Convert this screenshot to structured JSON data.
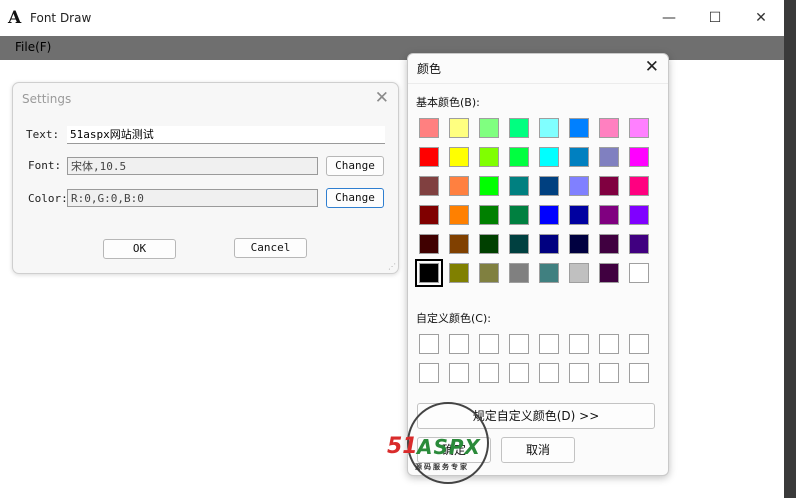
{
  "app": {
    "title": "Font Draw",
    "icon": "font-a-icon",
    "window_buttons": {
      "minimize": "—",
      "maximize": "☐",
      "close": "✕"
    }
  },
  "menu": {
    "file": "File(F)"
  },
  "settings": {
    "title": "Settings",
    "text_label": "Text:",
    "text_value": "51aspx网站测试",
    "font_label": "Font:",
    "font_value": "宋体,10.5",
    "color_label": "Color:",
    "color_value": "R:0,G:0,B:0",
    "change_font": "Change",
    "change_color": "Change",
    "ok": "OK",
    "cancel": "Cancel"
  },
  "color_dialog": {
    "title": "颜色",
    "basic_label": "基本颜色(B):",
    "custom_label": "自定义颜色(C):",
    "define_button": "规定自定义颜色(D) >>",
    "ok": "确定",
    "cancel": "取消",
    "selected": "#000000",
    "basic_colors": [
      [
        "#ff8080",
        "#ffff80",
        "#80ff80",
        "#00ff80",
        "#80ffff",
        "#0080ff",
        "#ff80c0",
        "#ff80ff"
      ],
      [
        "#ff0000",
        "#ffff00",
        "#80ff00",
        "#00ff40",
        "#00ffff",
        "#0080c0",
        "#8080c0",
        "#ff00ff"
      ],
      [
        "#804040",
        "#ff8040",
        "#00ff00",
        "#008080",
        "#004080",
        "#8080ff",
        "#800040",
        "#ff0080"
      ],
      [
        "#800000",
        "#ff8000",
        "#008000",
        "#008040",
        "#0000ff",
        "#0000a0",
        "#800080",
        "#8000ff"
      ],
      [
        "#400000",
        "#804000",
        "#004000",
        "#004040",
        "#000080",
        "#000040",
        "#400040",
        "#400080"
      ],
      [
        "#000000",
        "#808000",
        "#808040",
        "#808080",
        "#408080",
        "#c0c0c0",
        "#400040",
        "#ffffff"
      ]
    ]
  },
  "watermark": {
    "brand_a": "51",
    "brand_b": "ASPX",
    "tagline": "源码服务专家"
  }
}
